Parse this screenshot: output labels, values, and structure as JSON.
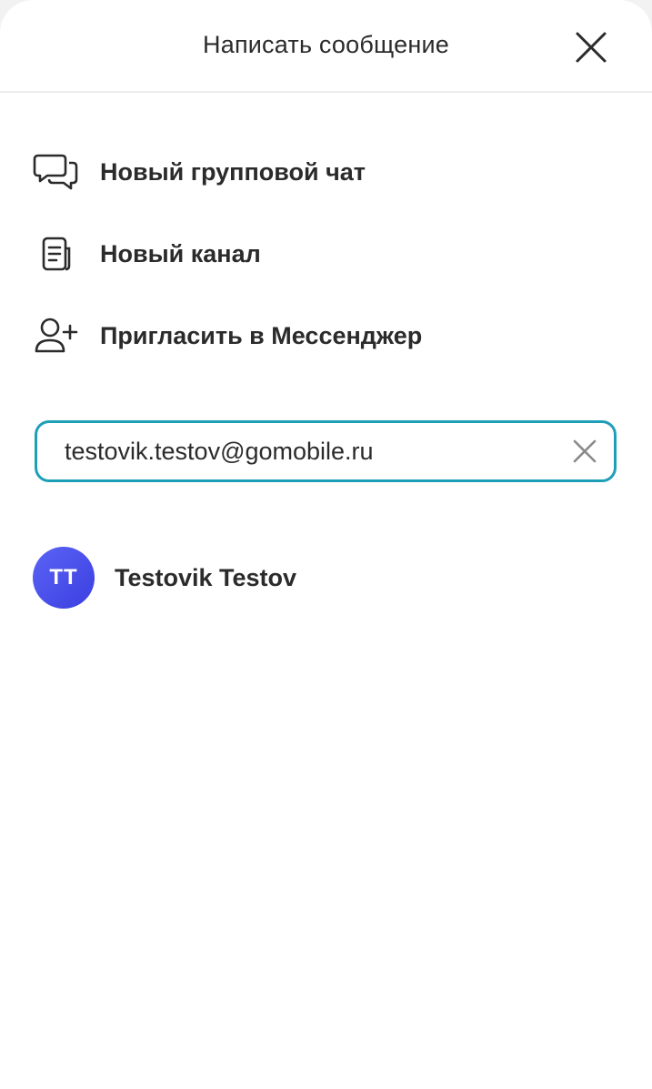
{
  "header": {
    "title": "Написать сообщение",
    "close_icon": "close-icon"
  },
  "menu": [
    {
      "label": "Новый групповой чат",
      "icon": "chat-bubbles-icon"
    },
    {
      "label": "Новый канал",
      "icon": "channel-document-icon"
    },
    {
      "label": "Пригласить в Мессенджер",
      "icon": "add-user-icon"
    }
  ],
  "search": {
    "value": "testovik.testov@gomobile.ru",
    "clear_icon": "clear-icon",
    "border_color": "#1e9fb8"
  },
  "results": [
    {
      "initials": "TT",
      "name": "Testovik Testov",
      "avatar_color": "#4a4ff0"
    }
  ]
}
